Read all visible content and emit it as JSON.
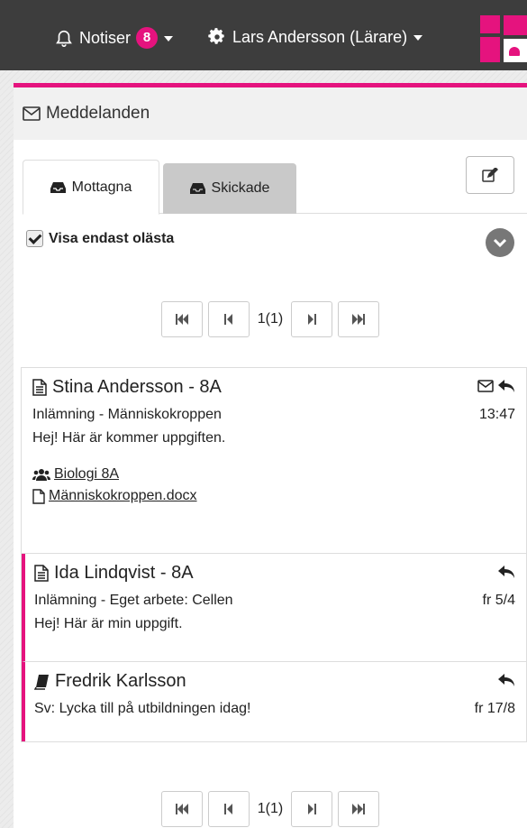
{
  "topbar": {
    "notifications_label": "Notiser",
    "notifications_count": "8",
    "user_label": "Lars Andersson (Lärare)"
  },
  "panel": {
    "title": "Meddelanden",
    "tabs": [
      {
        "label": "Mottagna",
        "active": true
      },
      {
        "label": "Skickade",
        "active": false
      }
    ],
    "filter_label": "Visa endast olästa",
    "filter_checked": true
  },
  "pager": {
    "info": "1(1)"
  },
  "messages": [
    {
      "sender": "Stina Andersson - 8A",
      "subject": "Inlämning - Människokroppen",
      "time": "13:47",
      "preview": "Hej! Här är kommer uppgiften.",
      "group_link": "Biologi 8A",
      "file_link": "Människokroppen.docx",
      "icon": "document-icon"
    },
    {
      "sender": "Ida Lindqvist - 8A",
      "subject": "Inlämning - Eget arbete: Cellen",
      "time": "fr 5/4",
      "preview": "Hej! Här är min uppgift.",
      "icon": "document-icon"
    },
    {
      "sender": "Fredrik Karlsson",
      "subject": "Sv: Lycka till på utbildningen idag!",
      "time": "fr 17/8",
      "icon": "book-icon"
    }
  ],
  "colors": {
    "accent": "#e5137e",
    "topbar": "#3d3d3d"
  }
}
